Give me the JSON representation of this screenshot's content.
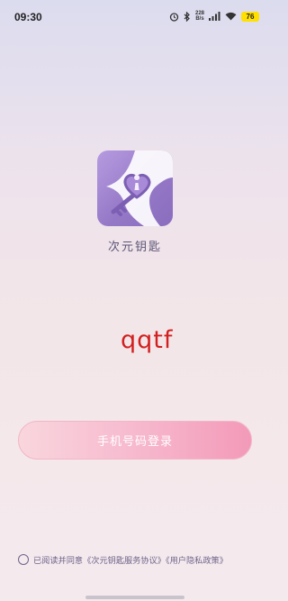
{
  "status_bar": {
    "time": "09:30",
    "network_speed_value": "228",
    "network_speed_unit": "B/s",
    "battery_level": "76",
    "battery_color": "#ffe000"
  },
  "app": {
    "logo_icon": "heart-key-icon",
    "name": "次元钥匙"
  },
  "captcha_text": "qqtf",
  "login_button_label": "手机号码登录",
  "agreement": {
    "text": "已阅读并同意《次元钥匙服务协议》《用户隐私政策》",
    "checked": false
  },
  "colors": {
    "accent_purple": "#9579c7",
    "button_pink": "#f39ab9",
    "captcha_red": "#d21f1f"
  }
}
